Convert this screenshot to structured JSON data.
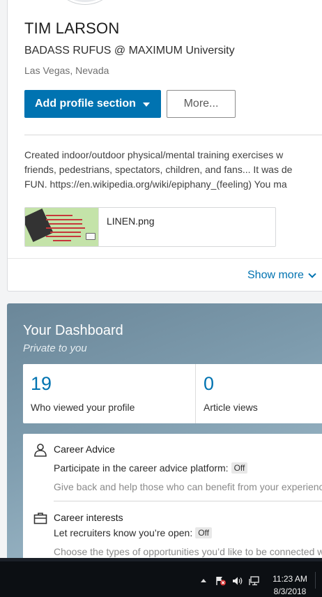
{
  "profile": {
    "name": "TIM LARSON",
    "headline": "BADASS RUFUS @ MAXIMUM University",
    "location": "Las Vegas, Nevada",
    "add_section_label": "Add profile section",
    "more_label": "More...",
    "summary_lines": [
      "Created indoor/outdoor physical/mental training exercises w",
      "friends, pedestrians, spectators, children, and fans... It was de",
      "FUN. https://en.wikipedia.org/wiki/epiphany_(feeling) You ma"
    ],
    "media_name": "LINEN.png",
    "show_more_label": "Show more"
  },
  "dashboard": {
    "title": "Your Dashboard",
    "subtitle": "Private to you",
    "stats": [
      {
        "value": "19",
        "label": "Who viewed your profile"
      },
      {
        "value": "0",
        "label": "Article views"
      }
    ],
    "rows": [
      {
        "icon": "person-icon",
        "title": "Career Advice",
        "setting": "Participate in the career advice platform:",
        "status": "Off",
        "description": "Give back and help those who can benefit from your experienc"
      },
      {
        "icon": "briefcase-icon",
        "title": "Career interests",
        "setting": "Let recruiters know you’re open:",
        "status": "Off",
        "description": "Choose the types of opportunities you’d like to be connected w"
      }
    ]
  },
  "taskbar": {
    "time": "11:23 AM",
    "date": "8/3/2018"
  },
  "colors": {
    "accent": "#0073b1",
    "dashboard_bg": "#7e9cae",
    "taskbar_bg": "#0c0f13"
  }
}
